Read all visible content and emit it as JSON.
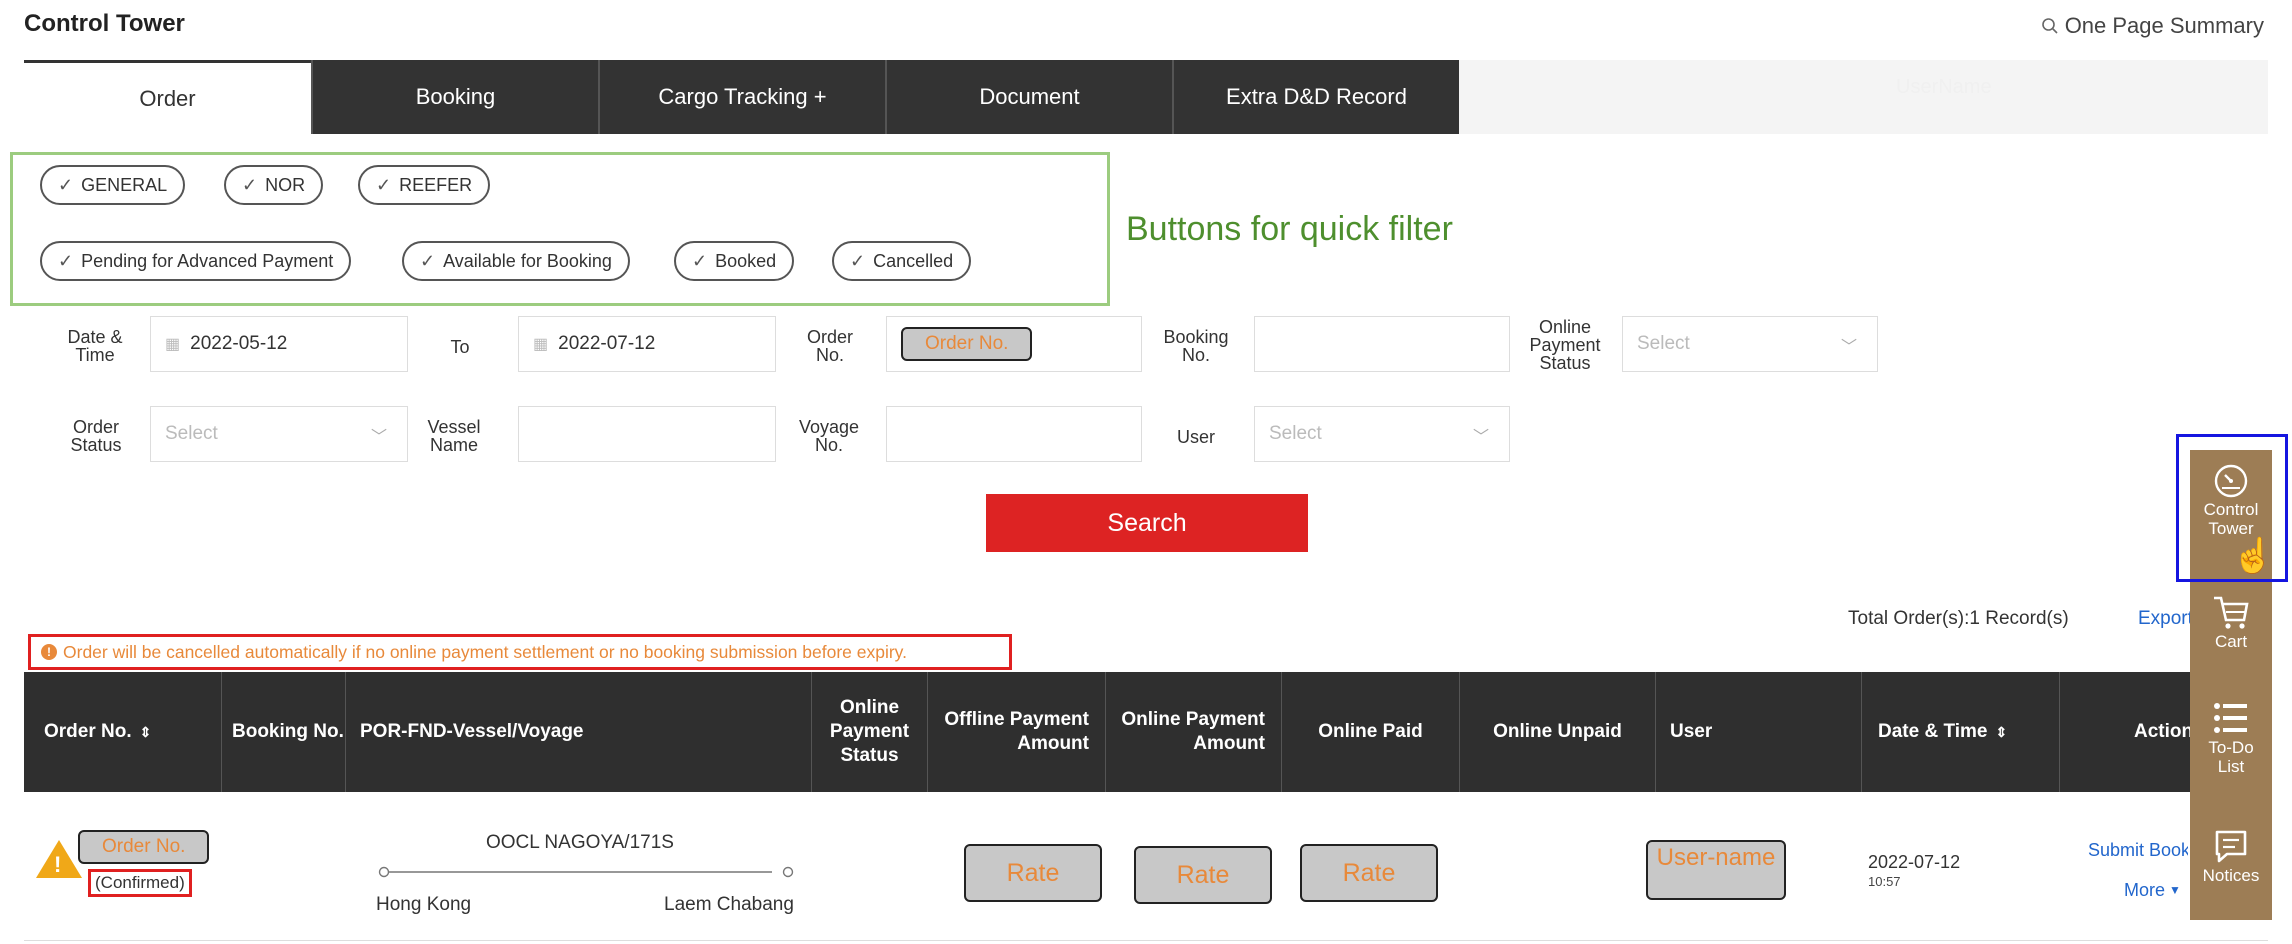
{
  "header": {
    "title": "Control Tower",
    "summary_label": "One Page Summary",
    "username_ghost": "UserName"
  },
  "tabs": [
    {
      "label": "Order",
      "active": true
    },
    {
      "label": "Booking"
    },
    {
      "label": "Cargo Tracking +"
    },
    {
      "label": "Document"
    },
    {
      "label": "Extra D&D Record"
    }
  ],
  "quick_filters": {
    "row1": [
      "GENERAL",
      "NOR",
      "REEFER"
    ],
    "row2": [
      "Pending for Advanced Payment",
      "Available for Booking",
      "Booked",
      "Cancelled"
    ],
    "annotation": "Buttons for quick filter"
  },
  "filters": {
    "date_time_label": "Date & Time",
    "date_from": "2022-05-12",
    "to_label": "To",
    "date_to": "2022-07-12",
    "order_no_label": "Order No.",
    "order_no_value": "Order No.",
    "booking_no_label": "Booking No.",
    "online_payment_status_label": "Online Payment Status",
    "online_payment_status_placeholder": "Select",
    "order_status_label": "Order Status",
    "order_status_placeholder": "Select",
    "vessel_name_label": "Vessel Name",
    "voyage_no_label": "Voyage No.",
    "user_label": "User",
    "user_placeholder": "Select",
    "search_label": "Search"
  },
  "summary": {
    "total": "Total Order(s):1 Record(s)",
    "export": "Export"
  },
  "warning": "Order will be cancelled automatically if no online payment settlement or no booking submission before expiry.",
  "table": {
    "headers": {
      "order_no": "Order No.",
      "booking_no": "Booking No.",
      "por": "POR-FND-Vessel/Voyage",
      "online_payment_status": "Online Payment Status",
      "offline_payment_amount": "Offline Payment Amount",
      "online_payment_amount": "Online Payment Amount",
      "online_paid": "Online Paid",
      "online_unpaid": "Online Unpaid",
      "user": "User",
      "date_time": "Date & Time",
      "action": "Action"
    },
    "row": {
      "order_no": "Order No.",
      "status": "(Confirmed)",
      "vessel_voyage": "OOCL NAGOYA/171S",
      "origin": "Hong Kong",
      "destination": "Laem Chabang",
      "rate1": "Rate",
      "rate2": "Rate",
      "rate3": "Rate",
      "user": "User-name",
      "date": "2022-07-12",
      "time": "10:57",
      "action_submit": "Submit Booking",
      "action_more": "More"
    }
  },
  "sidebar": {
    "control_tower": "Control Tower",
    "cart": "Cart",
    "todo": "To-Do List",
    "notices": "Notices"
  }
}
